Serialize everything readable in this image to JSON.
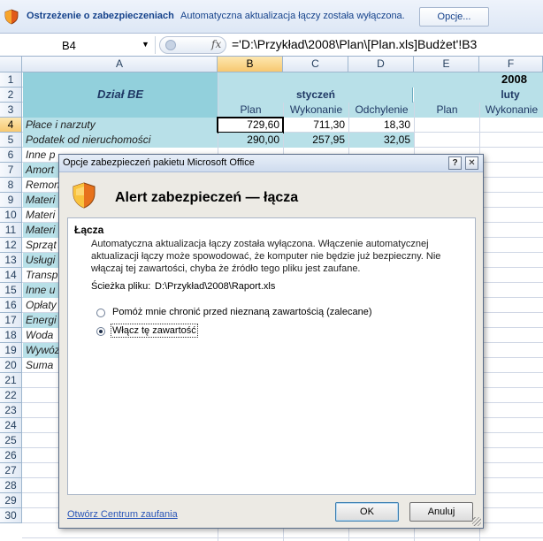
{
  "security_bar": {
    "title": "Ostrzeżenie o zabezpieczeniach",
    "message": "Automatyczna aktualizacja łączy została wyłączona.",
    "options_button": "Opcje..."
  },
  "formula_bar": {
    "name_box": "B4",
    "fx": "fx",
    "formula": "='D:\\Przykład\\2008\\Plan\\[Plan.xls]Budżet'!B3"
  },
  "sheet": {
    "columns": [
      "A",
      "B",
      "C",
      "D",
      "E",
      "F"
    ],
    "rows": [
      "1",
      "2",
      "3",
      "4",
      "5",
      "6",
      "7",
      "8",
      "9",
      "10",
      "11",
      "12",
      "13",
      "14",
      "15",
      "16",
      "17",
      "18",
      "19",
      "20",
      "21",
      "22",
      "23",
      "24",
      "25",
      "26",
      "27",
      "28",
      "29",
      "30"
    ],
    "header_label": "Dział BE",
    "year": "2008",
    "month1": "styczeń",
    "month2": "luty",
    "sub_headers": [
      "Plan",
      "Wykonanie",
      "Odchylenie",
      "Plan",
      "Wykonanie"
    ],
    "data_rows": [
      {
        "label": "Płace i narzuty",
        "plan": "729,60",
        "wyk": "711,30",
        "odch": "18,30"
      },
      {
        "label": "Podatek od nieruchomości",
        "plan": "290,00",
        "wyk": "257,95",
        "odch": "32,05"
      }
    ],
    "partial_labels": [
      "Inne p",
      "Amort",
      "Remon",
      "Materi",
      "Materi",
      "Materi",
      "Sprząt",
      "Usługi",
      "Transp",
      "Inne u",
      "Opłaty",
      "Energi",
      "Woda",
      "Wywóz",
      "Suma"
    ]
  },
  "dialog": {
    "title": "Opcje zabezpieczeń pakietu Microsoft Office",
    "help_button": "?",
    "close_button": "✕",
    "heading": "Alert zabezpieczeń — łącza",
    "section": "Łącza",
    "description": "Automatyczna aktualizacja łączy została wyłączona. Włączenie automatycznej aktualizacji łączy może spowodować, że komputer nie będzie już bezpieczny. Nie włączaj tej zawartości, chyba że źródło tego pliku jest zaufane.",
    "path_label": "Ścieżka pliku:",
    "path_value": "D:\\Przykład\\2008\\Raport.xls",
    "option_protect": "Pomóż mnie chronić przed nieznaną zawartością (zalecane)",
    "option_enable": "Włącz tę zawartość",
    "selected_option": "enable",
    "trust_center_link": "Otwórz Centrum zaufania",
    "ok_button": "OK",
    "cancel_button": "Anuluj"
  }
}
